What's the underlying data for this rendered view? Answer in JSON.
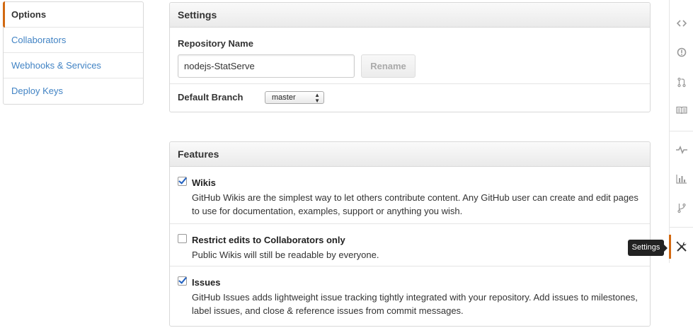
{
  "sidebar": {
    "items": [
      {
        "label": "Options",
        "selected": true
      },
      {
        "label": "Collaborators",
        "selected": false
      },
      {
        "label": "Webhooks & Services",
        "selected": false
      },
      {
        "label": "Deploy Keys",
        "selected": false
      }
    ]
  },
  "settings": {
    "header": "Settings",
    "repo_name_label": "Repository Name",
    "repo_name_value": "nodejs-StatServe",
    "rename_label": "Rename",
    "default_branch_label": "Default Branch",
    "default_branch_value": "master"
  },
  "features": {
    "header": "Features",
    "items": [
      {
        "title": "Wikis",
        "checked": true,
        "description": "GitHub Wikis are the simplest way to let others contribute content. Any GitHub user can create and edit pages to use for documentation, examples, support or anything you wish."
      },
      {
        "title": "Restrict edits to Collaborators only",
        "checked": false,
        "description": "Public Wikis will still be readable by everyone."
      },
      {
        "title": "Issues",
        "checked": true,
        "description": "GitHub Issues adds lightweight issue tracking tightly integrated with your repository. Add issues to milestones, label issues, and close & reference issues from commit messages."
      }
    ]
  },
  "rail": {
    "icons": [
      "code-icon",
      "issues-icon",
      "pull-request-icon",
      "wiki-icon",
      "pulse-icon",
      "graphs-icon",
      "network-icon",
      "settings-icon"
    ],
    "active": "settings-icon",
    "tooltip": "Settings"
  },
  "colors": {
    "accent": "#d26911",
    "link": "#4183c4"
  }
}
